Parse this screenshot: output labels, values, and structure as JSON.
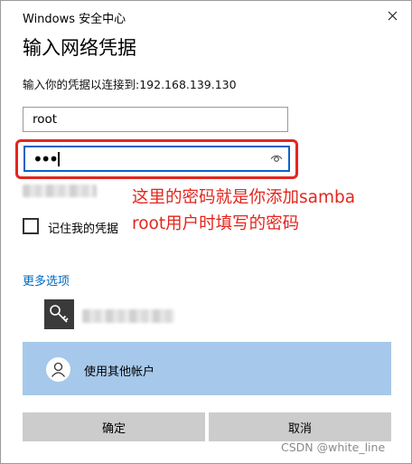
{
  "window": {
    "title": "Windows 安全中心",
    "heading": "输入网络凭据",
    "prompt": "输入你的凭据以连接到:192.168.139.130"
  },
  "form": {
    "username_value": "root",
    "password_mask": "•••",
    "remember_label": "记住我的凭据",
    "remember_checked": false
  },
  "annotation": {
    "line1": "这里的密码就是你添加samba",
    "line2": "root用户时填写的密码",
    "color": "#e3261e"
  },
  "more_options": {
    "label": "更多选项",
    "other_account_label": "使用其他帐户"
  },
  "buttons": {
    "ok_label": "确定",
    "cancel_label": "取消"
  },
  "icons": {
    "close": "close-icon",
    "reveal": "eye-icon",
    "certificate": "key-icon",
    "account": "person-icon"
  },
  "colors": {
    "accent": "#0067c0",
    "focus_border": "#0a63c9",
    "highlight_box": "#e3261e",
    "selected_row": "#a6c8ea",
    "button_bg": "#cccccc"
  },
  "watermark": "CSDN @white_line"
}
